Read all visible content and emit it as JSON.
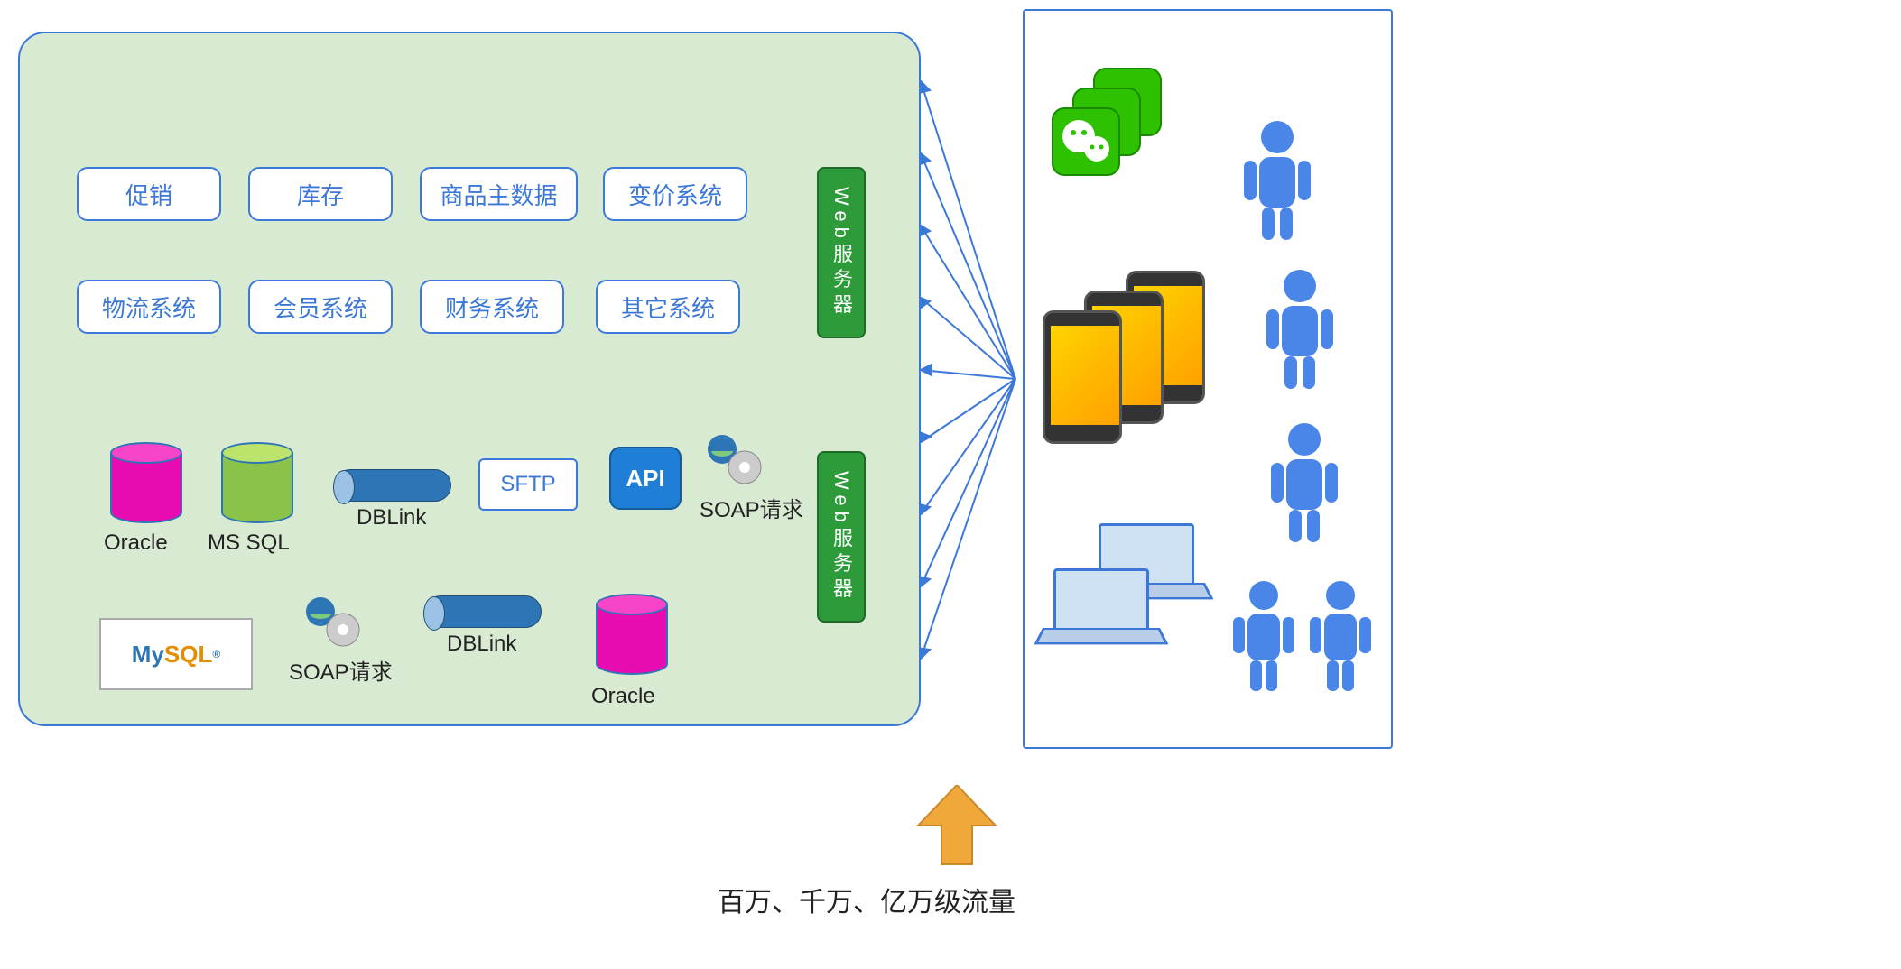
{
  "systems_row1": {
    "promo": "促销",
    "stock": "库存",
    "product": "商品主数据",
    "pricing": "变价系统"
  },
  "systems_row2": {
    "logistics": "物流系统",
    "member": "会员系统",
    "finance": "财务系统",
    "other": "其它系统"
  },
  "db": {
    "oracle1": "Oracle",
    "mssql": "MS SQL",
    "oracle2": "Oracle",
    "mysql": "MySQL"
  },
  "integration": {
    "dblink1": "DBLink",
    "dblink2": "DBLink",
    "sftp": "SFTP",
    "api": "API",
    "soap1": "SOAP请求",
    "soap2": "SOAP请求"
  },
  "servers": {
    "web1": "Web服务器",
    "web2": "Web服务器"
  },
  "traffic_label": "百万、千万、亿万级流量",
  "clients": {
    "wechat": "wechat-icons",
    "phones": "mobile-phones",
    "laptops": "laptops",
    "people": "users"
  }
}
